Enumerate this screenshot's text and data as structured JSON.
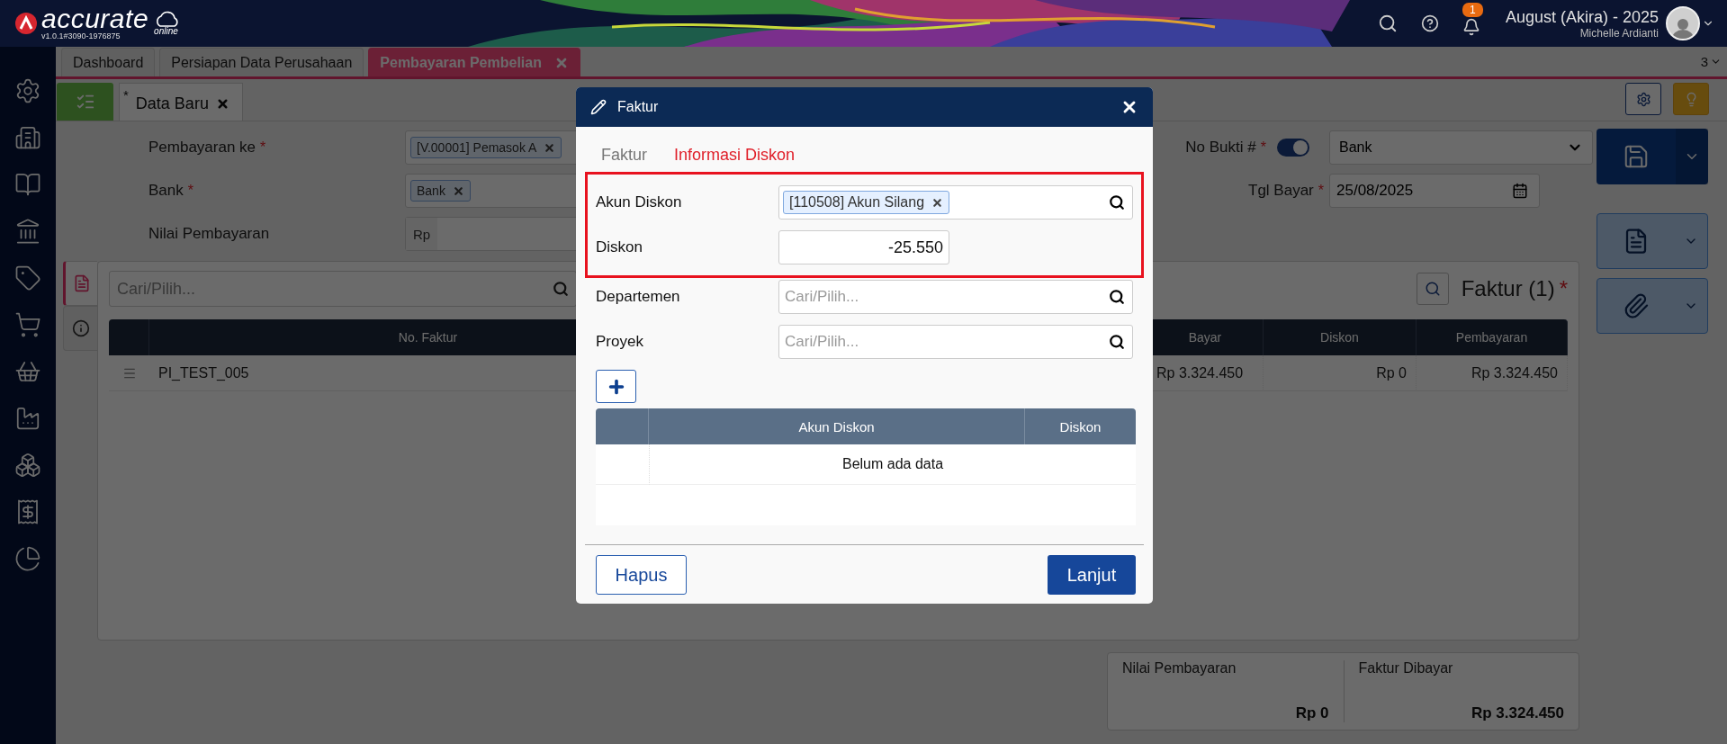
{
  "app": {
    "brand": "accurate",
    "brand_sub": "online",
    "version": "v1.0.1#3090-1976875",
    "notifications": "1",
    "company": "August (Akira) - 2025",
    "user": "Michelle Ardianti"
  },
  "tabs": [
    {
      "label": "Dashboard",
      "selected": false,
      "closable": false
    },
    {
      "label": "Persiapan Data Perusahaan",
      "selected": false,
      "closable": false
    },
    {
      "label": "Pembayaran Pembelian",
      "selected": true,
      "closable": true
    }
  ],
  "tab_count": "3",
  "doc_tab": {
    "mark": "*",
    "label": "Data Baru"
  },
  "form": {
    "fields": [
      {
        "label": "Pembayaran ke",
        "mark": "*",
        "kind": "tags",
        "tags": [
          "[V.00001] Pemasok A"
        ]
      },
      {
        "label": "Bank",
        "mark": "*",
        "kind": "tags",
        "tags": [
          "Bank"
        ]
      },
      {
        "label": "Nilai Pembayaran",
        "kind": "money",
        "prefix": "Rp"
      }
    ],
    "no_bukti": {
      "label": "No Bukti #",
      "mark": "*",
      "on": true,
      "value": "Bank"
    },
    "tgl_bayar": {
      "label": "Tgl Bayar",
      "mark": "*",
      "value": "25/08/2025"
    }
  },
  "detail": {
    "side_tabs": [
      {
        "kind": "document",
        "selected": true
      },
      {
        "kind": "info",
        "selected": false
      }
    ],
    "search_placeholder": "Cari/Pilih...",
    "title": "Faktur (1)",
    "mark": "*",
    "columns": [
      "No. Faktur",
      "Bayar",
      "Diskon",
      "Pembayaran"
    ],
    "rows": [
      {
        "no_faktur": "PI_TEST_005",
        "bayar": "Rp 3.324.450",
        "diskon": "Rp 0",
        "pembayaran": "Rp 3.324.450"
      }
    ]
  },
  "totals": [
    {
      "label": "Nilai Pembayaran",
      "value": "Rp 0"
    },
    {
      "label": "Faktur Dibayar",
      "value": "Rp 3.324.450"
    }
  ],
  "dialog": {
    "title": "Faktur",
    "tabs": [
      {
        "label": "Faktur",
        "selected": false
      },
      {
        "label": "Informasi Diskon",
        "selected": true
      }
    ],
    "fields": [
      {
        "label": "Akun Diskon",
        "kind": "tags",
        "tags": [
          "[110508] Akun Silang"
        ],
        "highlighted": true
      },
      {
        "label": "Diskon",
        "kind": "number",
        "value": "-25.550",
        "highlighted": true
      },
      {
        "label": "Departemen",
        "kind": "search",
        "placeholder": "Cari/Pilih...",
        "highlighted": false
      },
      {
        "label": "Proyek",
        "kind": "search",
        "placeholder": "Cari/Pilih...",
        "highlighted": false
      }
    ],
    "table": {
      "columns": [
        "Akun Diskon",
        "Diskon"
      ],
      "empty_text": "Belum ada data"
    },
    "buttons": [
      {
        "label": "Hapus",
        "kind": "secondary"
      },
      {
        "label": "Lanjut",
        "kind": "primary"
      }
    ]
  }
}
